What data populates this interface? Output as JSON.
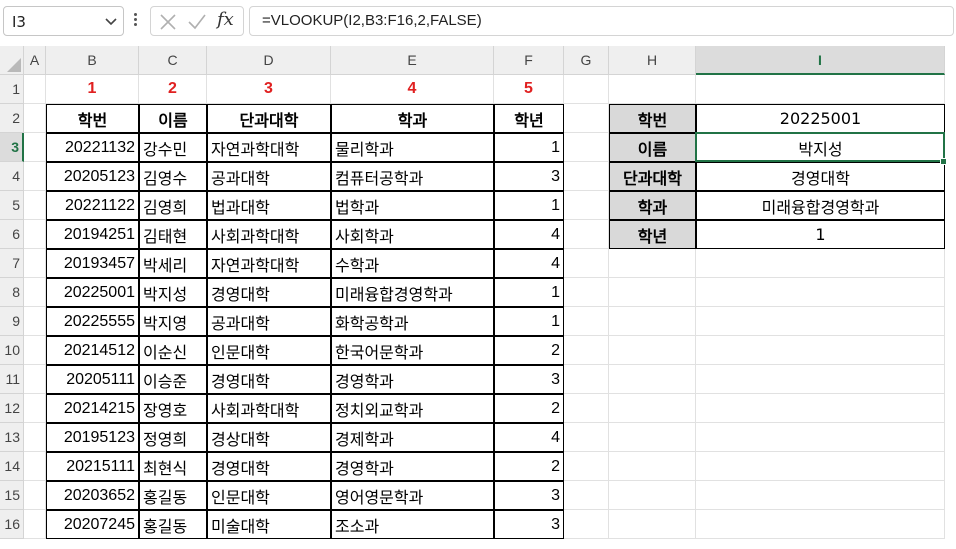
{
  "name_box": {
    "value": "I3"
  },
  "formula_bar": {
    "formula": "=VLOOKUP(I2,B3:F16,2,FALSE)"
  },
  "columns": [
    "A",
    "B",
    "C",
    "D",
    "E",
    "F",
    "G",
    "H",
    "I"
  ],
  "rows": [
    "1",
    "2",
    "3",
    "4",
    "5",
    "6",
    "7",
    "8",
    "9",
    "10",
    "11",
    "12",
    "13",
    "14",
    "15",
    "16"
  ],
  "selected_column": "I",
  "selected_row": "3",
  "index_row": [
    "1",
    "2",
    "3",
    "4",
    "5"
  ],
  "table": {
    "headers": [
      "학번",
      "이름",
      "단과대학",
      "학과",
      "학년"
    ],
    "rows": [
      [
        "20221132",
        "강수민",
        "자연과학대학",
        "물리학과",
        "1"
      ],
      [
        "20205123",
        "김영수",
        "공과대학",
        "컴퓨터공학과",
        "3"
      ],
      [
        "20221122",
        "김영희",
        "법과대학",
        "법학과",
        "1"
      ],
      [
        "20194251",
        "김태현",
        "사회과학대학",
        "사회학과",
        "4"
      ],
      [
        "20193457",
        "박세리",
        "자연과학대학",
        "수학과",
        "4"
      ],
      [
        "20225001",
        "박지성",
        "경영대학",
        "미래융합경영학과",
        "1"
      ],
      [
        "20225555",
        "박지영",
        "공과대학",
        "화학공학과",
        "1"
      ],
      [
        "20214512",
        "이순신",
        "인문대학",
        "한국어문학과",
        "2"
      ],
      [
        "20205111",
        "이승준",
        "경영대학",
        "경영학과",
        "3"
      ],
      [
        "20214215",
        "장영호",
        "사회과학대학",
        "정치외교학과",
        "2"
      ],
      [
        "20195123",
        "정영희",
        "경상대학",
        "경제학과",
        "4"
      ],
      [
        "20215111",
        "최현식",
        "경영대학",
        "경영학과",
        "2"
      ],
      [
        "20203652",
        "홍길동",
        "인문대학",
        "영어영문학과",
        "3"
      ],
      [
        "20207245",
        "홍길동",
        "미술대학",
        "조소과",
        "3"
      ]
    ]
  },
  "lookup": [
    {
      "label": "학번",
      "value": "20225001"
    },
    {
      "label": "이름",
      "value": "박지성"
    },
    {
      "label": "단과대학",
      "value": "경영대학"
    },
    {
      "label": "학과",
      "value": "미래융합경영학과"
    },
    {
      "label": "학년",
      "value": "1"
    }
  ],
  "colors": {
    "accent": "#217346",
    "index_red": "#e02020",
    "label_fill": "#d9d9d9"
  }
}
